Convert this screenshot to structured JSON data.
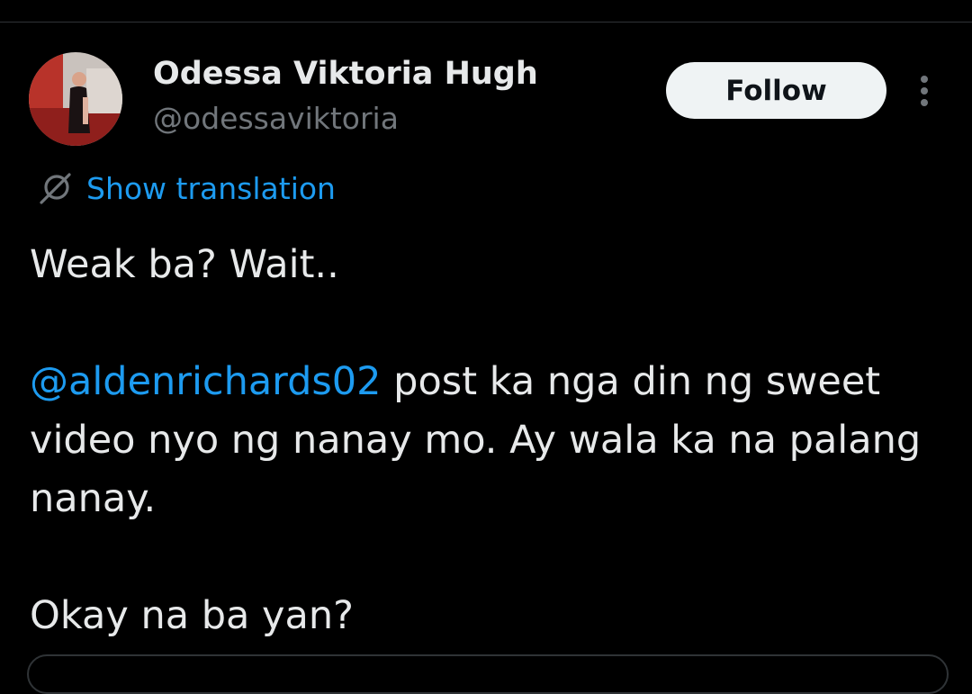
{
  "tweet": {
    "author": {
      "display_name": "Odessa Viktoria Hugh",
      "handle": "@odessaviktoria"
    },
    "follow_label": "Follow",
    "translation_label": "Show translation",
    "body": {
      "line1": "Weak ba? Wait..",
      "mention": "@aldenrichards02",
      "line2_rest": " post ka nga din ng sweet video nyo ng nanay mo. Ay wala ka na palang nanay.",
      "line3": "Okay na ba yan?"
    }
  },
  "colors": {
    "background": "#000000",
    "text_primary": "#e7e9ea",
    "text_secondary": "#71767b",
    "link": "#1d9bf0",
    "button_bg": "#eff3f4",
    "button_text": "#0f1419",
    "divider": "#2f3336"
  },
  "icons": {
    "avatar": "avatar-photo",
    "more": "more-dots-icon",
    "translate": "translate-icon"
  }
}
